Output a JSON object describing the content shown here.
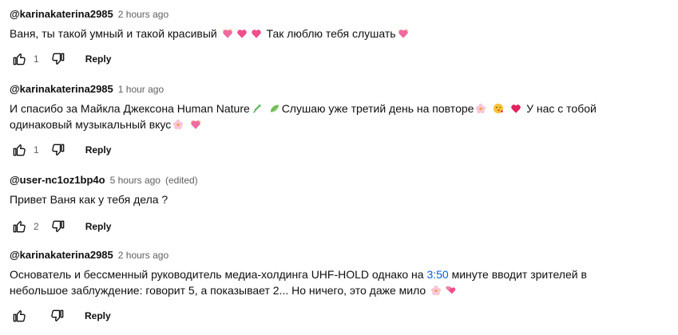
{
  "comments": [
    {
      "author": "@karinakaterina2985",
      "time": "2 hours ago",
      "edited": "",
      "text_before": "Ваня, ты такой умный и такой красивый",
      "emojis_a": [
        "sparkling-heart",
        "growing-heart",
        "beating-heart"
      ],
      "text_mid": "Так люблю тебя слушать",
      "emojis_b": [
        "sparkling-heart"
      ],
      "likes": "1",
      "reply_label": "Reply"
    },
    {
      "author": "@karinakaterina2985",
      "time": "1 hour ago",
      "edited": "",
      "text_part1": "И спасибо за Майкла Джексона Human Nature",
      "text_part2": "Слушаю уже третий день на повторе",
      "text_part3": "У нас с тобой одинаковый музыкальный вкус",
      "likes": "1",
      "reply_label": "Reply"
    },
    {
      "author": "@user-nc1oz1bp4o",
      "time": "5 hours ago",
      "edited": "(edited)",
      "text": "Привет Ваня как у тебя дела ?",
      "likes": "2",
      "reply_label": "Reply"
    },
    {
      "author": "@karinakaterina2985",
      "time": "2 hours ago",
      "edited": "",
      "text_before_ts": "Основатель и бессменный руководитель медиа-холдинга UHF-HOLD однако на",
      "timestamp": "3:50",
      "text_after_ts": "минуте вводит зрителей в небольшое заблуждение: говорит 5, а показывает 2... Но ничего, это даже мило",
      "likes": "",
      "reply_label": "Reply"
    }
  ],
  "colors": {
    "link": "#065fd4",
    "meta": "#606060",
    "text": "#0f0f0f"
  }
}
